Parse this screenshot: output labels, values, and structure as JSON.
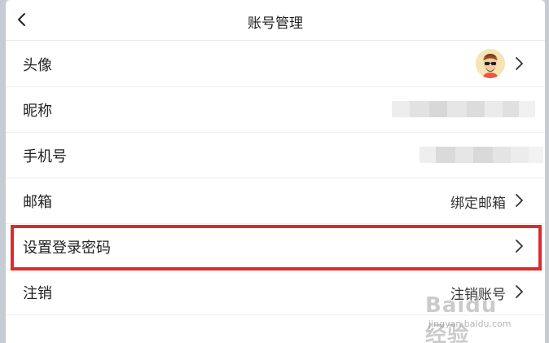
{
  "header": {
    "title": "账号管理"
  },
  "rows": [
    {
      "label": "头像",
      "value": ""
    },
    {
      "label": "昵称",
      "value": ""
    },
    {
      "label": "手机号",
      "value": ""
    },
    {
      "label": "邮箱",
      "value": "绑定邮箱"
    },
    {
      "label": "设置登录密码",
      "value": ""
    },
    {
      "label": "注销",
      "value": "注销账号"
    }
  ],
  "watermark": {
    "brand": "Baidu 经验",
    "url": "jingyan.baidu.com"
  },
  "colors": {
    "highlight": "#e02a2a",
    "avatar_bg": "#f6e4b5"
  },
  "icons": {
    "back": "chevron-left-icon",
    "row_arrow": "chevron-right-icon"
  }
}
